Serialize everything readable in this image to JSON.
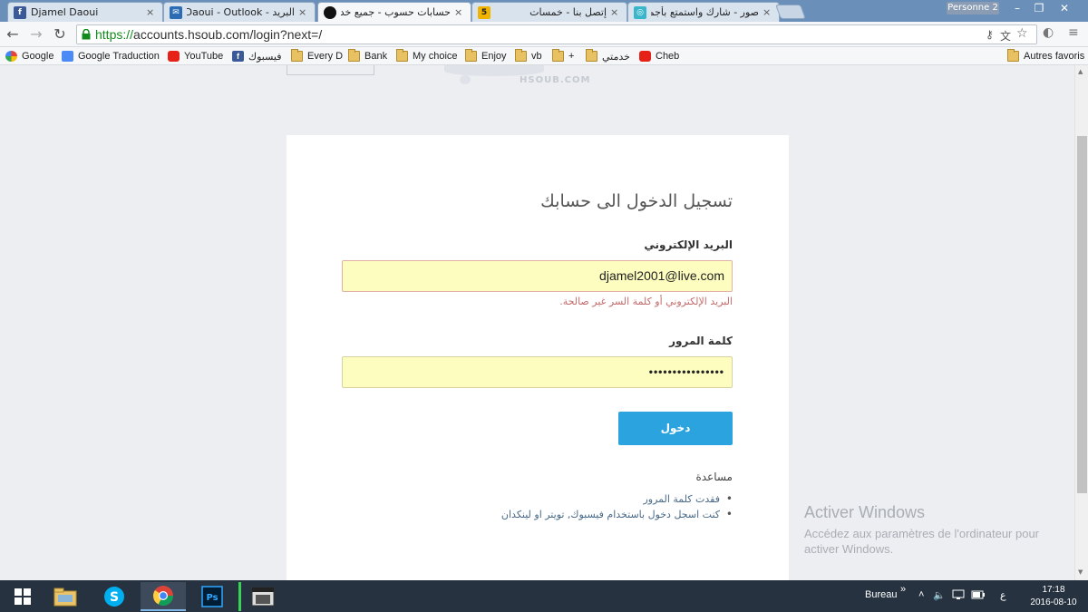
{
  "tabs": [
    {
      "title": "Djamel Daoui",
      "icon": "facebook-icon",
      "active": false
    },
    {
      "title": "البريد - Djamel Daoui - Outlook",
      "icon": "mail-icon",
      "active": false
    },
    {
      "title": "حسابات حسوب - جميع خدمات",
      "icon": "hsoub-icon",
      "active": true
    },
    {
      "title": "إتصل بنا - خمسات",
      "icon": "khamsat-icon",
      "active": false
    },
    {
      "title": "صور - شارك واستمتع بأجمل",
      "icon": "photos-icon",
      "active": false
    }
  ],
  "close_glyph": "×",
  "profile": "Personne 2",
  "window_controls": {
    "minimize": "–",
    "restore": "❐",
    "close": "✕"
  },
  "address": {
    "scheme": "https://",
    "rest": "accounts.hsoub.com/login?next=/"
  },
  "bookmarks": [
    {
      "label": "Google",
      "icon": "google-icon"
    },
    {
      "label": "Google Traduction",
      "icon": "translate-icon"
    },
    {
      "label": "YouTube",
      "icon": "youtube-icon"
    },
    {
      "label": "فيسبوك",
      "icon": "facebook-icon"
    },
    {
      "label": "Every D",
      "icon": "folder-icon"
    },
    {
      "label": "Bank",
      "icon": "folder-icon"
    },
    {
      "label": "My choice",
      "icon": "folder-icon"
    },
    {
      "label": "Enjoy",
      "icon": "folder-icon"
    },
    {
      "label": "vb",
      "icon": "folder-icon"
    },
    {
      "label": "+",
      "icon": "folder-icon"
    },
    {
      "label": "خدمتي",
      "icon": "folder-icon"
    },
    {
      "label": "Cheb",
      "icon": "youtube-icon"
    }
  ],
  "other_bookmarks": "Autres favoris",
  "logo_text": "HSOUB.COM",
  "login": {
    "title": "تسجيل الدخول الى حسابك",
    "email_label": "البريد الإلكتروني",
    "email_value": "djamel2001@live.com",
    "error": "البريد الإلكتروني أو كلمة السر غير صالحة.",
    "password_label": "كلمة المرور",
    "password_value": "••••••••••••••••",
    "submit": "دخول",
    "help_title": "مساعدة",
    "help_links": [
      "فقدت كلمة المرور",
      "كنت اسجل دخول باستخدام فيسبوك, تويتر او لينكدان"
    ]
  },
  "activate_windows": {
    "title": "Activer Windows",
    "body": "Accédez aux paramètres de l'ordinateur pour activer Windows."
  },
  "taskbar": {
    "apps": [
      "windows-start-icon",
      "file-explorer-icon",
      "skype-icon",
      "chrome-icon",
      "photoshop-icon",
      "video-editor-icon"
    ],
    "bureau": "Bureau",
    "chevron": "»",
    "lang": "ع",
    "time": "17:18",
    "date": "2016-08-10"
  },
  "colors": {
    "accent": "#2aa3de",
    "error": "#c56b6b",
    "field_bg": "#fdfdc0",
    "secure": "#128b1c"
  }
}
